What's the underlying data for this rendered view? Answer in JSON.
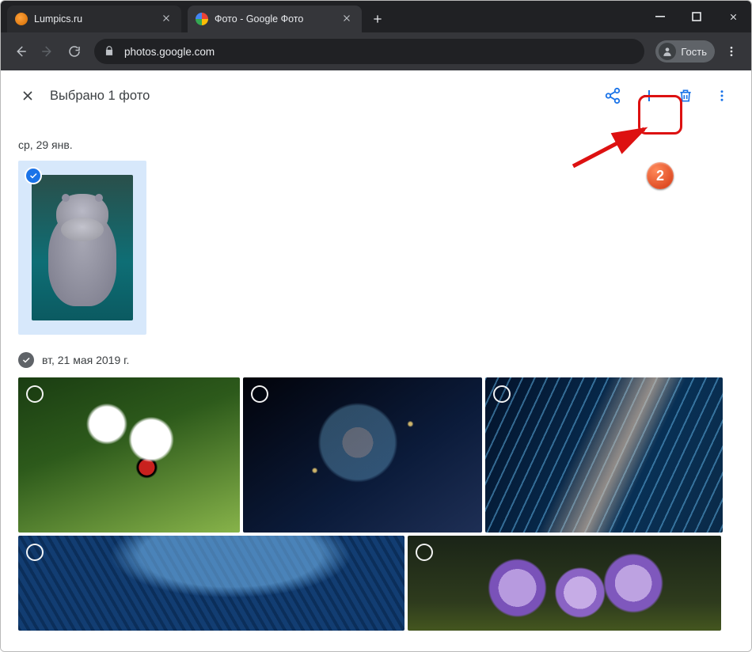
{
  "browser": {
    "tabs": [
      {
        "title": "Lumpics.ru"
      },
      {
        "title": "Фото - Google Фото"
      }
    ],
    "url": "photos.google.com",
    "profile_label": "Гость"
  },
  "page": {
    "selection_title": "Выбрано 1 фото",
    "date1": "ср, 29 янв.",
    "date2": "вт, 21 мая 2019 г."
  },
  "annotation": {
    "step": "2"
  }
}
